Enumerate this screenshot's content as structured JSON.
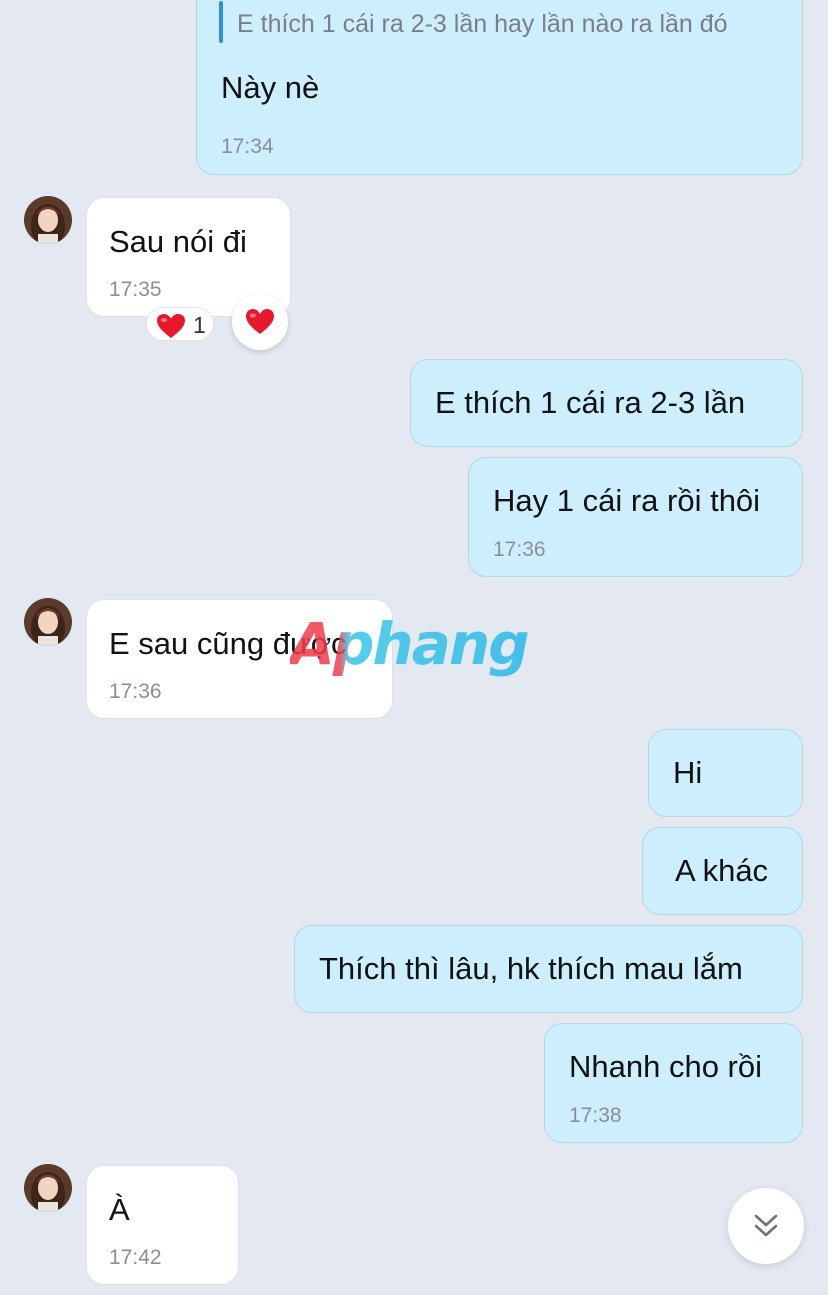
{
  "messages": [
    {
      "quote": "E thích 1 cái ra 2-3 lần hay lần nào ra lần đó",
      "text": "Này nè",
      "time": "17:34"
    },
    {
      "text": "Sau nói đi",
      "time": "17:35",
      "reaction": {
        "count": "1"
      }
    },
    {
      "text": "E thích 1 cái ra 2-3 lần"
    },
    {
      "text": "Hay 1 cái ra rồi thôi",
      "time": "17:36"
    },
    {
      "text": "E sau cũng được",
      "time": "17:36"
    },
    {
      "text": "Hi"
    },
    {
      "text": "A khác"
    },
    {
      "text": "Thích thì lâu, hk thích mau lắm"
    },
    {
      "text": "Nhanh cho rồi",
      "time": "17:38"
    },
    {
      "text": "À",
      "time": "17:42"
    }
  ],
  "watermark": "Aphang",
  "icons": {
    "avatar": "avatar",
    "reaction": "heart-icon",
    "scroll": "chevron-double-down-icon"
  },
  "colors": {
    "background": "#e3e8f1",
    "outgoing_bubble": "#cdeefd",
    "incoming_bubble": "#ffffff",
    "reply_bar": "#2f8fe0",
    "heart": "#e8182c"
  }
}
